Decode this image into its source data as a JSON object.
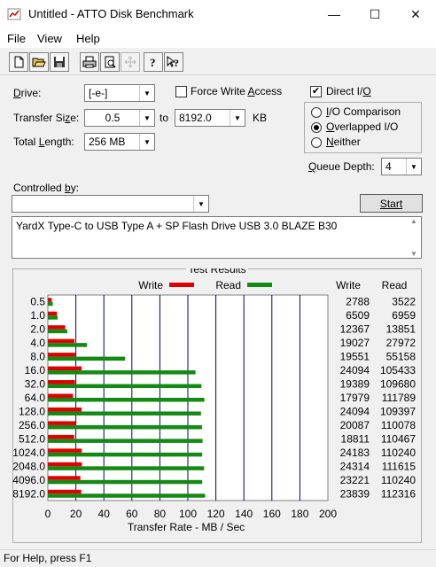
{
  "window": {
    "title": "Untitled - ATTO Disk Benchmark",
    "minimize": "—",
    "maximize": "☐",
    "close": "✕"
  },
  "menu": [
    "File",
    "View",
    "Help"
  ],
  "toolbar": {
    "icons": [
      "new-icon",
      "open-icon",
      "save-icon",
      "print-icon",
      "print-preview-icon",
      "move-icon",
      "help-icon",
      "context-help-icon"
    ]
  },
  "settings": {
    "drive_label": "Drive:",
    "drive_value": "[-e-]",
    "force_write_access_label": "Force Write Access",
    "force_write_access_checked": false,
    "direct_io_label": "Direct I/O",
    "direct_io_checked": true,
    "transfer_size_label": "Transfer Size:",
    "transfer_size_from": "0.5",
    "to_label": "to",
    "transfer_size_to": "8192.0",
    "kb_label": "KB",
    "total_length_label": "Total Length:",
    "total_length_value": "256 MB",
    "io_modes": [
      {
        "label": "I/O Comparison",
        "selected": false
      },
      {
        "label": "Overlapped I/O",
        "selected": true
      },
      {
        "label": "Neither",
        "selected": false
      }
    ],
    "queue_depth_label": "Queue Depth:",
    "queue_depth_value": "4",
    "controlled_by_label": "Controlled by:",
    "controlled_by_value": "",
    "start_label": "Start",
    "description": "YardX Type-C to USB Type A + SP Flash Drive USB 3.0 BLAZE B30"
  },
  "results": {
    "title": "Test Results",
    "legend_write": "Write",
    "legend_read": "Read",
    "col_write": "Write",
    "col_read": "Read",
    "write_color": "#e00000",
    "read_color": "#138a13",
    "grid_color": "#00007f",
    "rows": [
      {
        "size": "0.5",
        "write": "2788",
        "read": "3522"
      },
      {
        "size": "1.0",
        "write": "6509",
        "read": "6959"
      },
      {
        "size": "2.0",
        "write": "12367",
        "read": "13851"
      },
      {
        "size": "4.0",
        "write": "19027",
        "read": "27972"
      },
      {
        "size": "8.0",
        "write": "19551",
        "read": "55158"
      },
      {
        "size": "16.0",
        "write": "24094",
        "read": "105433"
      },
      {
        "size": "32.0",
        "write": "19389",
        "read": "109680"
      },
      {
        "size": "64.0",
        "write": "17979",
        "read": "111789"
      },
      {
        "size": "128.0",
        "write": "24094",
        "read": "109397"
      },
      {
        "size": "256.0",
        "write": "20087",
        "read": "110078"
      },
      {
        "size": "512.0",
        "write": "18811",
        "read": "110467"
      },
      {
        "size": "1024.0",
        "write": "24183",
        "read": "110240"
      },
      {
        "size": "2048.0",
        "write": "24314",
        "read": "111615"
      },
      {
        "size": "4096.0",
        "write": "23221",
        "read": "110240"
      },
      {
        "size": "8192.0",
        "write": "23839",
        "read": "112316"
      }
    ],
    "x_ticks": [
      "0",
      "20",
      "40",
      "60",
      "80",
      "100",
      "120",
      "140",
      "160",
      "180",
      "200"
    ],
    "x_label": "Transfer Rate - MB / Sec"
  },
  "chart_data": {
    "type": "bar",
    "title": "Test Results",
    "xlabel": "Transfer Rate - MB / Sec",
    "ylabel": "",
    "orientation": "horizontal",
    "xlim": [
      0,
      200
    ],
    "grid": true,
    "legend": "top",
    "categories": [
      "0.5",
      "1.0",
      "2.0",
      "4.0",
      "8.0",
      "16.0",
      "32.0",
      "64.0",
      "128.0",
      "256.0",
      "512.0",
      "1024.0",
      "2048.0",
      "4096.0",
      "8192.0"
    ],
    "series": [
      {
        "name": "Write",
        "color": "#e00000",
        "values": [
          2.788,
          6.509,
          12.367,
          19.027,
          19.551,
          24.094,
          19.389,
          17.979,
          24.094,
          20.087,
          18.811,
          24.183,
          24.314,
          23.221,
          23.839
        ]
      },
      {
        "name": "Read",
        "color": "#138a13",
        "values": [
          3.522,
          6.959,
          13.851,
          27.972,
          55.158,
          105.433,
          109.68,
          111.789,
          109.397,
          110.078,
          110.467,
          110.24,
          111.615,
          110.24,
          112.316
        ]
      }
    ]
  },
  "status": {
    "text": "For Help, press F1"
  }
}
